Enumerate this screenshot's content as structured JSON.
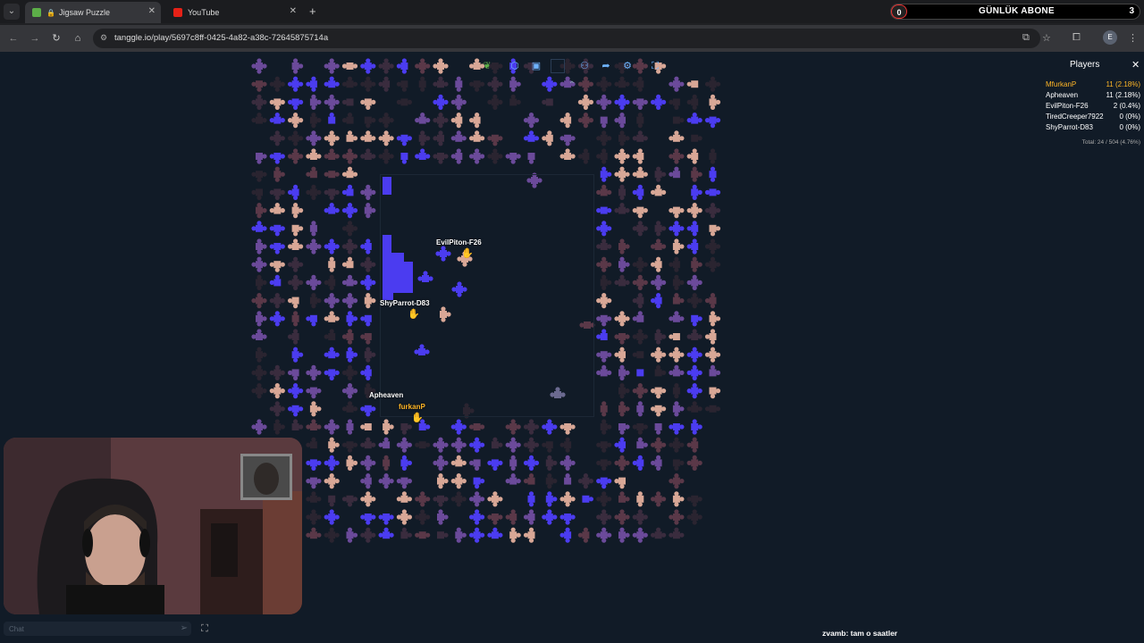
{
  "browser": {
    "tabs": [
      {
        "title": "Jigsaw Puzzle",
        "active": true,
        "favicon": "leaf-icon"
      },
      {
        "title": "YouTube",
        "active": false,
        "favicon": "youtube-icon"
      }
    ],
    "new_tab": "+",
    "url": "tanggle.io/play/5697c8ff-0425-4a82-a38c-72645875714a",
    "profile_initial": "E"
  },
  "extension_banner": {
    "left_count": "0",
    "title": "GÜNLÜK ABONE",
    "right_count": "3"
  },
  "players_panel": {
    "title": "Players",
    "players": [
      {
        "name": "MfurkanP",
        "score": "11 (2.18%)",
        "highlight": true
      },
      {
        "name": "Apheaven",
        "score": "11 (2.18%)",
        "highlight": false
      },
      {
        "name": "EvilPiton-F26",
        "score": "2 (0.4%)",
        "highlight": false
      },
      {
        "name": "TiredCreeper7922",
        "score": "0 (0%)",
        "highlight": false
      },
      {
        "name": "ShyParrot-D83",
        "score": "0 (0%)",
        "highlight": false
      }
    ],
    "total": "Total: 24 / 504 (4.76%)"
  },
  "cursors": [
    {
      "name": "EvilPiton-F26"
    },
    {
      "name": "ShyParrot-D83"
    },
    {
      "name": "Apheaven"
    },
    {
      "name": "furkanP"
    }
  ],
  "chat": {
    "placeholder": "Chat",
    "message_user": "zvamb:",
    "message_text": "tam o saatler"
  },
  "colors": {
    "background": "#111b27",
    "piece_blue": "#4b3cf0",
    "piece_peach": "#d8a796",
    "piece_purple": "#6b4a9a",
    "piece_dark": "#2a2430",
    "highlight": "#ffb627"
  }
}
